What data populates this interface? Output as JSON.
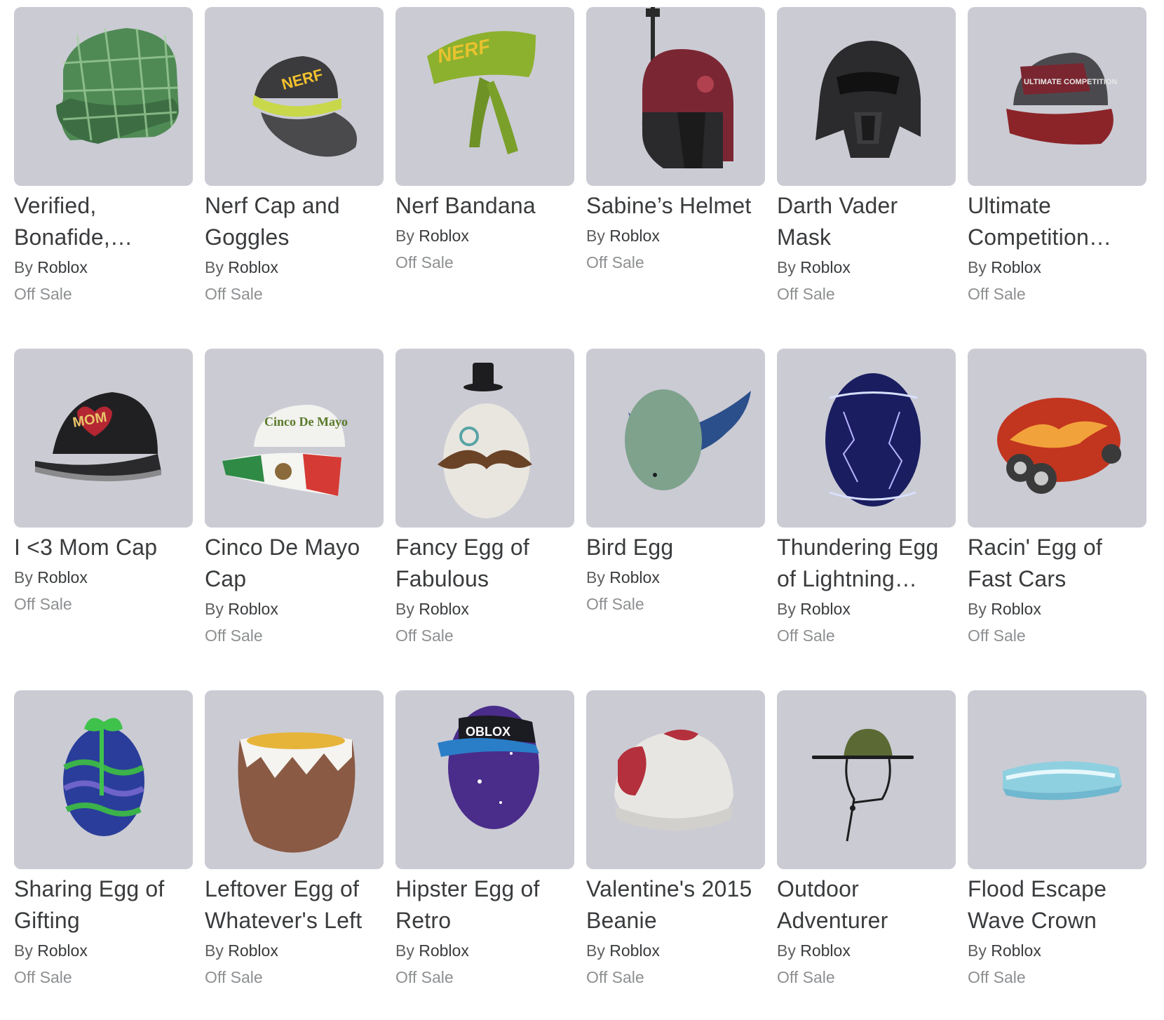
{
  "items": [
    {
      "name": "Verified, Bonafide,…",
      "by_prefix": "By",
      "creator": "Roblox",
      "status": "Off Sale"
    },
    {
      "name": "Nerf Cap and Goggles",
      "by_prefix": "By",
      "creator": "Roblox",
      "status": "Off Sale",
      "thumb_text": "NERF"
    },
    {
      "name": "Nerf Bandana",
      "by_prefix": "By",
      "creator": "Roblox",
      "status": "Off Sale",
      "thumb_text": "NERF"
    },
    {
      "name": "Sabine’s Helmet",
      "by_prefix": "By",
      "creator": "Roblox",
      "status": "Off Sale"
    },
    {
      "name": "Darth Vader Mask",
      "by_prefix": "By",
      "creator": "Roblox",
      "status": "Off Sale"
    },
    {
      "name": "Ultimate Competition…",
      "by_prefix": "By",
      "creator": "Roblox",
      "status": "Off Sale",
      "thumb_text": "ULTIMATE COMPETITION"
    },
    {
      "name": "I <3 Mom Cap",
      "by_prefix": "By",
      "creator": "Roblox",
      "status": "Off Sale",
      "thumb_text": "MOM"
    },
    {
      "name": "Cinco De Mayo Cap",
      "by_prefix": "By",
      "creator": "Roblox",
      "status": "Off Sale",
      "thumb_text": "Cinco De Mayo"
    },
    {
      "name": "Fancy Egg of Fabulous",
      "by_prefix": "By",
      "creator": "Roblox",
      "status": "Off Sale"
    },
    {
      "name": "Bird Egg",
      "by_prefix": "By",
      "creator": "Roblox",
      "status": "Off Sale"
    },
    {
      "name": "Thundering Egg of Lightning…",
      "by_prefix": "By",
      "creator": "Roblox",
      "status": "Off Sale"
    },
    {
      "name": "Racin' Egg of Fast Cars",
      "by_prefix": "By",
      "creator": "Roblox",
      "status": "Off Sale"
    },
    {
      "name": "Sharing Egg of Gifting",
      "by_prefix": "By",
      "creator": "Roblox",
      "status": "Off Sale"
    },
    {
      "name": "Leftover Egg of Whatever's Left",
      "by_prefix": "By",
      "creator": "Roblox",
      "status": "Off Sale"
    },
    {
      "name": "Hipster Egg of Retro",
      "by_prefix": "By",
      "creator": "Roblox",
      "status": "Off Sale",
      "thumb_text": "OBLOX"
    },
    {
      "name": "Valentine's 2015 Beanie",
      "by_prefix": "By",
      "creator": "Roblox",
      "status": "Off Sale"
    },
    {
      "name": "Outdoor Adventurer",
      "by_prefix": "By",
      "creator": "Roblox",
      "status": "Off Sale"
    },
    {
      "name": "Flood Escape Wave Crown",
      "by_prefix": "By",
      "creator": "Roblox",
      "status": "Off Sale"
    }
  ],
  "icons": [
    "plaid-cap-icon",
    "nerf-cap-icon",
    "nerf-bandana-icon",
    "sabine-helmet-icon",
    "vader-mask-icon",
    "competition-cap-icon",
    "mom-cap-icon",
    "cinco-cap-icon",
    "fancy-egg-icon",
    "bird-egg-icon",
    "thunder-egg-icon",
    "racing-egg-icon",
    "gift-egg-icon",
    "leftover-egg-icon",
    "hipster-egg-icon",
    "beanie-icon",
    "adventurer-hat-icon",
    "wave-crown-icon"
  ],
  "colors": {
    "thumb_bg": "#cbcbd4",
    "name": "#393b3d",
    "by": "#606162",
    "status": "#8d8f91"
  }
}
